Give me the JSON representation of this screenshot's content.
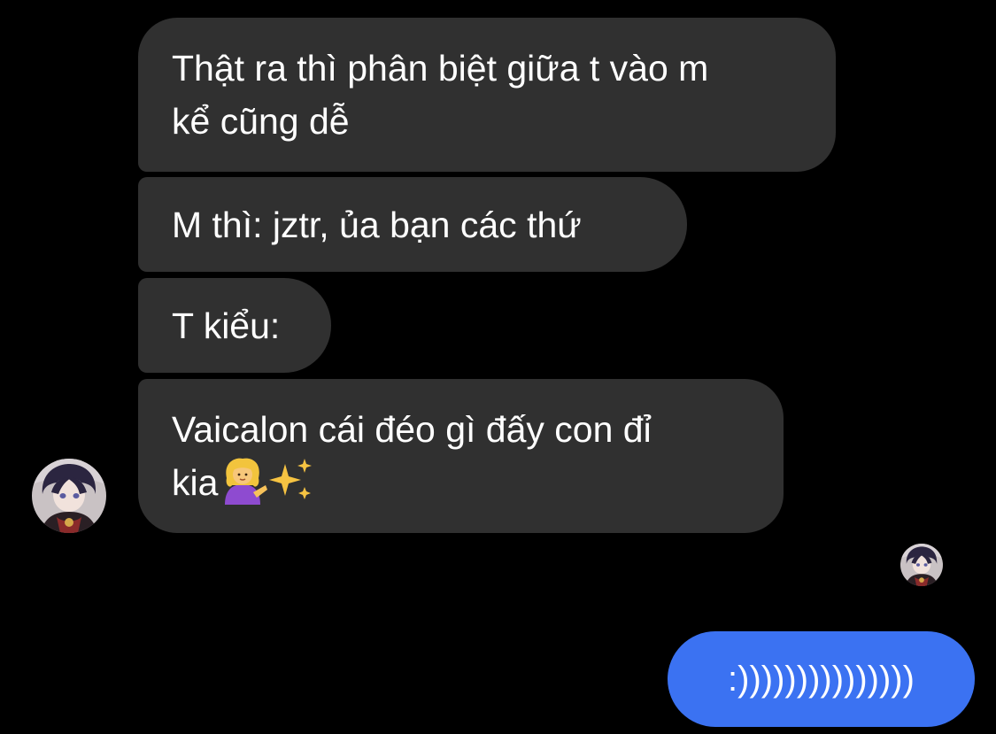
{
  "messages": {
    "m1": "Thật ra thì phân biệt giữa t vào m\nkể cũng dễ",
    "m2": "M thì: jztr, ủa bạn các thứ",
    "m3": "T kiểu:",
    "m4_text": "Vaicalon cái đéo gì đấy con đỉ\nkia",
    "m5": ":)))))))))))))))"
  },
  "icons": {
    "emoji_1": "person-tipping-hand-emoji",
    "emoji_2": "sparkles-emoji",
    "avatar": "anime-character-avatar"
  },
  "colors": {
    "background": "#000000",
    "incoming_bubble": "#303030",
    "outgoing_bubble": "#3b72f2",
    "text": "#ffffff"
  }
}
